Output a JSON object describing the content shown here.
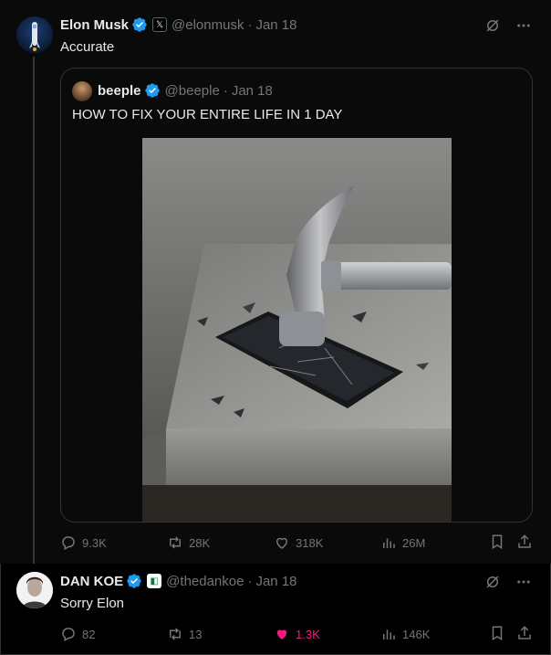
{
  "main_tweet": {
    "author_name": "Elon Musk",
    "handle": "@elonmusk",
    "separator": "·",
    "date": "Jan 18",
    "affiliate_badge": "𝕏",
    "text": "Accurate",
    "quote": {
      "author_name": "beeple",
      "handle": "@beeple",
      "separator": "·",
      "date": "Jan 18",
      "text": "HOW TO FIX YOUR ENTIRE LIFE IN 1 DAY",
      "image_subject": "hammer smashing smartphone on stone block"
    },
    "actions": {
      "replies": "9.3K",
      "reposts": "28K",
      "likes": "318K",
      "views": "26M"
    }
  },
  "reply_tweet": {
    "author_name": "DAN KOE",
    "handle": "@thedankoe",
    "separator": "·",
    "date": "Jan 18",
    "affiliate_badge": "◧",
    "text": "Sorry Elon",
    "actions": {
      "replies": "82",
      "reposts": "13",
      "likes": "1.3K",
      "views": "146K",
      "liked": true
    }
  },
  "colors": {
    "verified_blue": "#1d9bf0",
    "like_pink": "#f91880",
    "muted_text": "#71767b",
    "primary_text": "#e7e9ea"
  }
}
